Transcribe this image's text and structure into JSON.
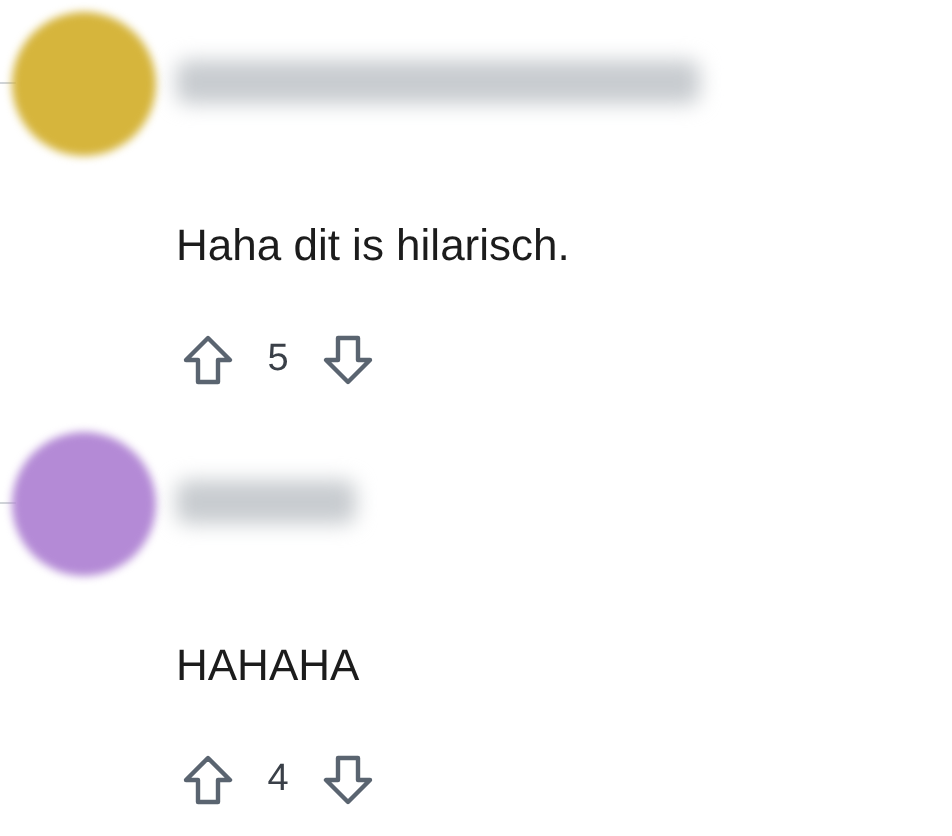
{
  "comments": [
    {
      "color": "#d6b53c",
      "text": "Haha dit is hilarisch.",
      "votes": "5"
    },
    {
      "color": "#b48ad6",
      "text": "HAHAHA",
      "votes": "4"
    }
  ]
}
